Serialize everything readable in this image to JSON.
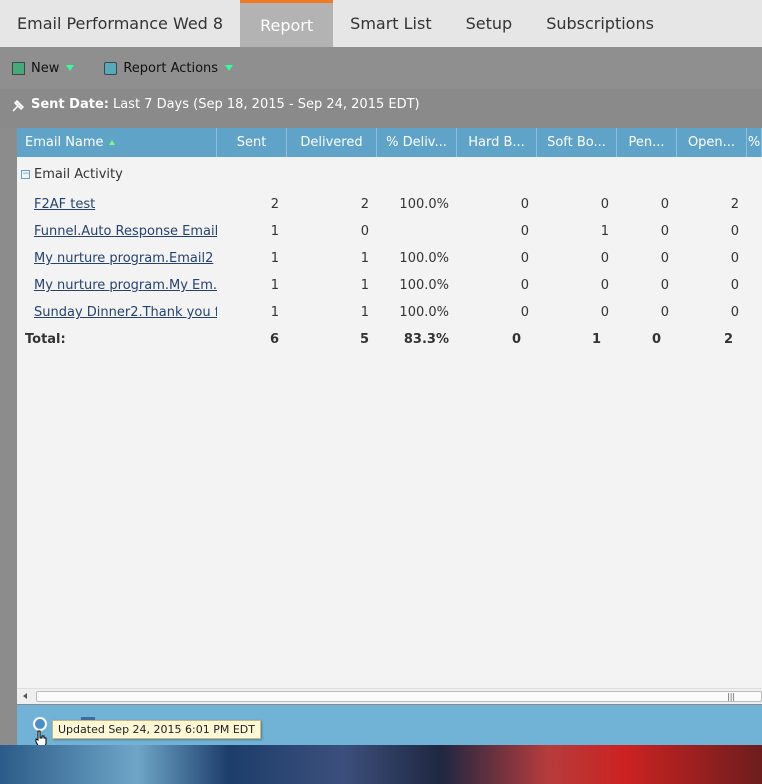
{
  "tabs": [
    {
      "label": "Email Performance Wed 8",
      "active": false
    },
    {
      "label": "Report",
      "active": true
    },
    {
      "label": "Smart List",
      "active": false
    },
    {
      "label": "Setup",
      "active": false
    },
    {
      "label": "Subscriptions",
      "active": false
    }
  ],
  "toolbar": {
    "new_label": "New",
    "report_actions_label": "Report Actions"
  },
  "filter": {
    "label": "Sent Date:",
    "value": "Last 7 Days (Sep 18, 2015 - Sep 24, 2015 EDT)"
  },
  "grid": {
    "columns": [
      "Email Name",
      "Sent",
      "Delivered",
      "% Deliv...",
      "Hard B...",
      "Soft Bo...",
      "Pen...",
      "Open...",
      "%"
    ],
    "group_label": "Email Activity",
    "rows": [
      {
        "name": "F2AF test",
        "sent": "2",
        "delivered": "2",
        "pct": "100.0%",
        "hard": "0",
        "soft": "0",
        "pen": "0",
        "open": "2"
      },
      {
        "name": "Funnel.Auto Response Email...",
        "sent": "1",
        "delivered": "0",
        "pct": "",
        "hard": "0",
        "soft": "1",
        "pen": "0",
        "open": "0"
      },
      {
        "name": "My nurture program.Email2",
        "sent": "1",
        "delivered": "1",
        "pct": "100.0%",
        "hard": "0",
        "soft": "0",
        "pen": "0",
        "open": "0"
      },
      {
        "name": "My nurture program.My Em...",
        "sent": "1",
        "delivered": "1",
        "pct": "100.0%",
        "hard": "0",
        "soft": "0",
        "pen": "0",
        "open": "0"
      },
      {
        "name": "Sunday Dinner2.Thank you f...",
        "sent": "1",
        "delivered": "1",
        "pct": "100.0%",
        "hard": "0",
        "soft": "0",
        "pen": "0",
        "open": "0"
      }
    ],
    "total": {
      "label": "Total:",
      "sent": "6",
      "delivered": "5",
      "pct": "83.3%",
      "hard": "0",
      "soft": "1",
      "pen": "0",
      "open": "2"
    }
  },
  "status": {
    "tooltip": "Updated Sep 24, 2015 6:01 PM EDT"
  },
  "colors": {
    "accent_tab": "#f07a22",
    "header_blue": "#5fa3c9",
    "link": "#26436f"
  }
}
